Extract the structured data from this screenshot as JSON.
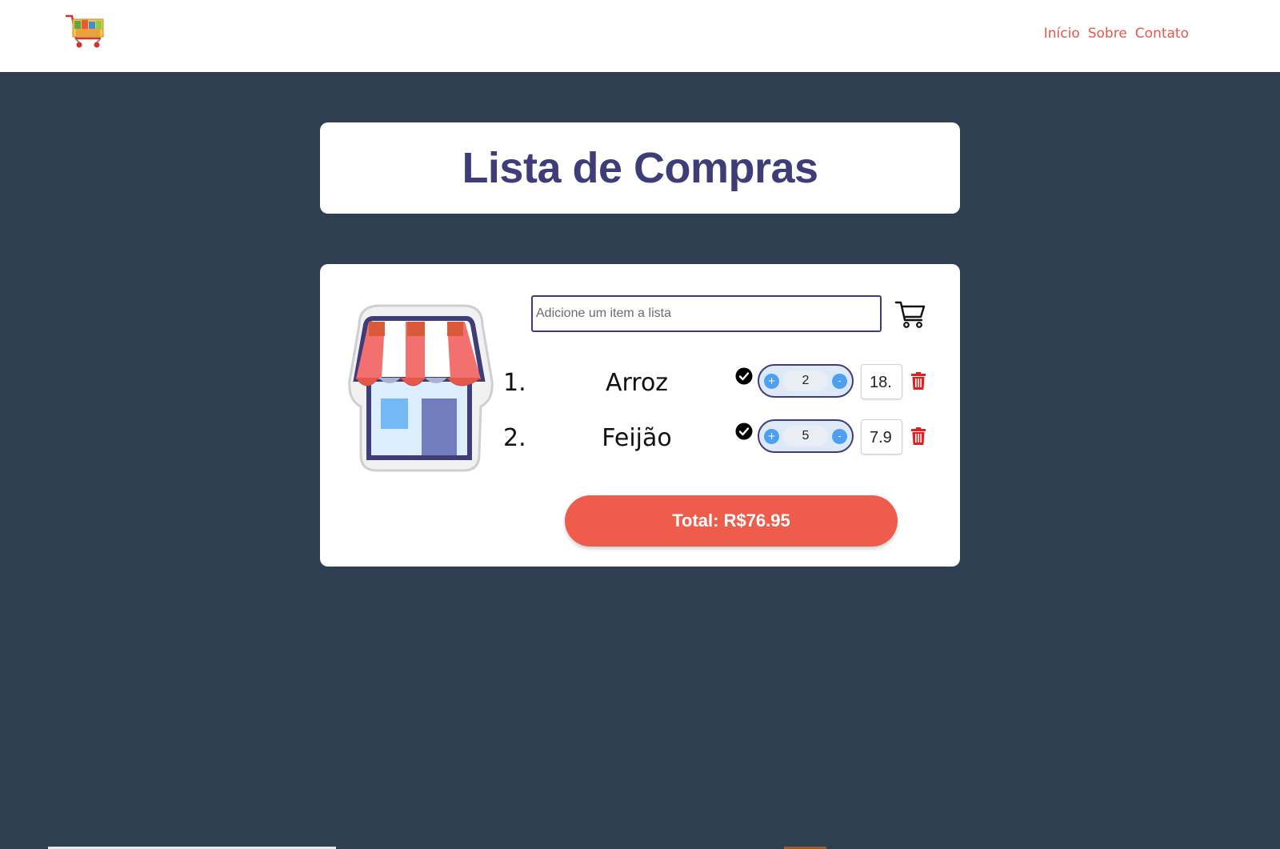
{
  "nav": {
    "links": [
      "Início",
      "Sobre",
      "Contato"
    ]
  },
  "title": "Lista de Compras",
  "input": {
    "placeholder": "Adicione um item a lista",
    "value": ""
  },
  "items": [
    {
      "number": "1.",
      "name": "Arroz",
      "quantity": "2",
      "price": "18."
    },
    {
      "number": "2.",
      "name": "Feijão",
      "quantity": "5",
      "price": "7.9"
    }
  ],
  "stepper": {
    "plus": "+",
    "minus": "-"
  },
  "total_label": "Total: R$76.95",
  "colors": {
    "background": "#2f3f51",
    "accent": "#ee5d4c",
    "title": "#3e3d78",
    "nav_link": "#e4584a",
    "stepper_button": "#4d9ff0",
    "trash": "#e02020"
  },
  "icons": {
    "logo": "shopping-cart-logo",
    "store": "store-icon",
    "cart": "cart-icon",
    "check": "check-circle-icon",
    "trash": "trash-icon"
  }
}
